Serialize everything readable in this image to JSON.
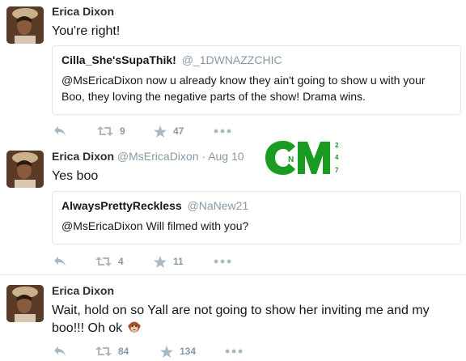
{
  "tweets": [
    {
      "name": "Erica Dixon",
      "handle": "",
      "time": "",
      "text": "You're right!",
      "quote": {
        "name": "Cilla_She'sSupaThik!",
        "handle": "@_1DWNAZZCHIC",
        "text": "@MsEricaDixon now u already know they ain't going to show u with your Boo, they loving the negative parts of the show! Drama wins."
      },
      "retweets": "9",
      "likes": "47"
    },
    {
      "name": "Erica Dixon",
      "handle": "@MsEricaDixon",
      "dot": "·",
      "time": "Aug 10",
      "text": "Yes boo",
      "quote": {
        "name": "AlwaysPrettyReckless",
        "handle": "@NaNew21",
        "text": "@MsEricaDixon Will filmed with you?"
      },
      "retweets": "4",
      "likes": "11"
    },
    {
      "name": "Erica Dixon",
      "handle": "",
      "time": "",
      "text": "Wait, hold on so Yall are not going to show her inviting me and my boo!!! Oh ok",
      "emoji": "monkey-face-emoji",
      "retweets": "84",
      "likes": "134"
    }
  ],
  "watermark": {
    "letters": "CM",
    "inner": "N",
    "digits": [
      "2",
      "4",
      "7"
    ],
    "color": "#1a9b22"
  },
  "colors": {
    "name": "#292f33",
    "muted": "#8899a6",
    "icon": "#aab8c2",
    "border": "#e1e8ed"
  }
}
